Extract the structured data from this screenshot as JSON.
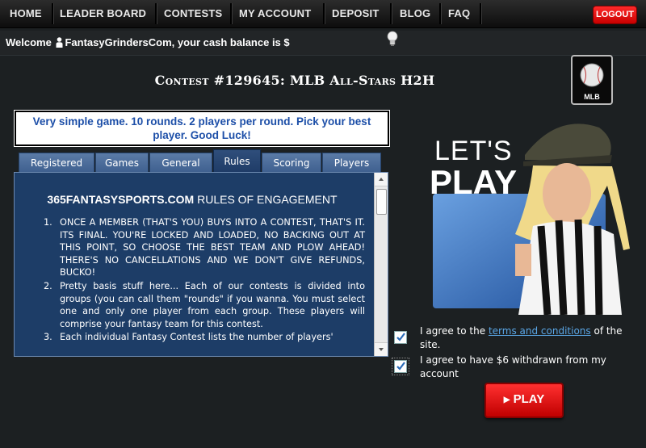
{
  "nav": {
    "items": [
      "HOME",
      "LEADER BOARD",
      "CONTESTS",
      "MY ACCOUNT",
      "DEPOSIT",
      "BLOG",
      "FAQ"
    ],
    "logout_label": "LOGOUT"
  },
  "welcome": {
    "prefix": "Welcome",
    "username": "FantasyGrindersCom",
    "suffix": ", your cash balance is $"
  },
  "contest": {
    "title": "Contest #129645: MLB All-Stars H2H",
    "sport_badge": "MLB",
    "description": "Very simple game. 10 rounds. 2 players per round. Pick your best player. Good Luck!"
  },
  "tabs": [
    {
      "label": "Registered",
      "active": false
    },
    {
      "label": "Games",
      "active": false
    },
    {
      "label": "General",
      "active": false
    },
    {
      "label": "Rules",
      "active": true
    },
    {
      "label": "Scoring",
      "active": false
    },
    {
      "label": "Players",
      "active": false
    }
  ],
  "rules": {
    "heading_brand": "365FANTASYSPORTS.COM",
    "heading_rest": " RULES OF ENGAGEMENT",
    "items": [
      "ONCE A MEMBER (THAT'S YOU) BUYS INTO A CONTEST, THAT'S IT. ITS FINAL. YOU'RE LOCKED AND LOADED, NO BACKING OUT AT THIS POINT, SO CHOOSE THE BEST TEAM AND PLOW AHEAD! THERE'S NO CANCELLATIONS AND WE DON'T GIVE REFUNDS, BUCKO!",
      "Pretty basis stuff here... Each of our contests is divided into groups (you can call them \"rounds\" if you wanna. You must select one and only one player from each group. These players will comprise your fantasy team for this contest.",
      "Each individual Fantasy Contest lists the number of players'"
    ]
  },
  "promo": {
    "line1": "LET'S",
    "line2": "PLAY"
  },
  "agreements": {
    "terms_prefix": "I agree to the ",
    "terms_link": "terms and conditions",
    "terms_suffix": " of the site.",
    "terms_checked": true,
    "withdraw_text": "I agree to have $6 withdrawn from my account",
    "withdraw_checked": true
  },
  "play_button_label": "PLAY",
  "colors": {
    "nav_bg": "#111111",
    "accent_red": "#e00000",
    "panel_blue": "#1d3d67",
    "tab_blue": "#4a6b99",
    "link_blue": "#5aa6e6",
    "description_text": "#1d4fa8"
  }
}
